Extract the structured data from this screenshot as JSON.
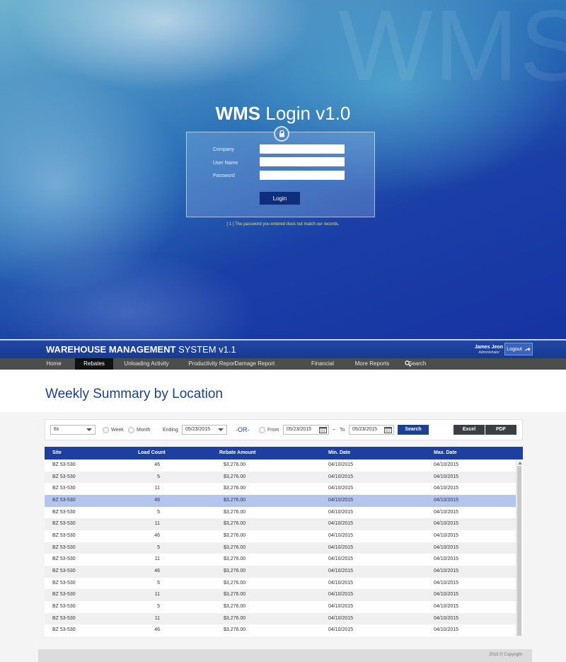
{
  "login": {
    "watermark": "WMS",
    "title_bold": "WMS",
    "title_light": "Login v1.0",
    "fields": [
      {
        "label": "Company",
        "value": ""
      },
      {
        "label": "User Name",
        "value": ""
      },
      {
        "label": "Password",
        "value": ""
      }
    ],
    "login_label": "Login",
    "error_message": "[ 1 ] The password you entered does not match our records."
  },
  "header": {
    "title_bold": "WAREHOUSE MANAGEMENT",
    "title_light": "SYSTEM v1.1",
    "user_name": "James Jeon",
    "user_role": "Administrator",
    "logout_label": "Logout"
  },
  "nav": {
    "items": [
      "Home",
      "Rebates",
      "Unloading Activity",
      "Productivity Report",
      "Damage Report",
      "Financial",
      "More Reports",
      "Search"
    ],
    "active": "Rebates"
  },
  "page": {
    "title": "Weekly Summary by Location"
  },
  "filters": {
    "location_select": "8x",
    "week_label": "Week",
    "month_label": "Month",
    "ending_label": "Ending",
    "ending_date": "05/23/2015",
    "or_label": "-OR-",
    "from_label": "From",
    "from_date": "05/23/2015",
    "tilde": "~",
    "to_label": "To",
    "to_date": "05/23/2015",
    "search_label": "Search",
    "excel_label": "Excel",
    "pdf_label": "PDF"
  },
  "table": {
    "columns": [
      "Site",
      "Load Count",
      "Rebate Amount",
      "Min. Date",
      "Max. Date"
    ],
    "rows": [
      [
        "BZ 53-530",
        "46",
        "$3,276.00",
        "04/10/2015",
        "04/10/2015"
      ],
      [
        "BZ 53-530",
        "5",
        "$3,276.00",
        "04/10/2015",
        "04/10/2015"
      ],
      [
        "BZ 53-530",
        "11",
        "$3,276.00",
        "04/10/2015",
        "04/10/2015"
      ],
      [
        "BZ 53-530",
        "46",
        "$3,276.00",
        "04/10/2015",
        "04/10/2015"
      ],
      [
        "BZ 53-530",
        "5",
        "$3,276.00",
        "04/10/2015",
        "04/10/2015"
      ],
      [
        "BZ 53-530",
        "11",
        "$3,276.00",
        "04/10/2015",
        "04/10/2015"
      ],
      [
        "BZ 53-530",
        "46",
        "$3,276.00",
        "04/10/2015",
        "04/10/2015"
      ],
      [
        "BZ 53-530",
        "5",
        "$3,276.00",
        "04/10/2015",
        "04/10/2015"
      ],
      [
        "BZ 53-530",
        "11",
        "$3,276.00",
        "04/10/2015",
        "04/10/2015"
      ],
      [
        "BZ 53-530",
        "46",
        "$3,276.00",
        "04/10/2015",
        "04/10/2015"
      ],
      [
        "BZ 53-530",
        "5",
        "$3,276.00",
        "04/10/2015",
        "04/10/2015"
      ],
      [
        "BZ 53-530",
        "11",
        "$3,276.00",
        "04/10/2015",
        "04/10/2015"
      ],
      [
        "BZ 53-530",
        "5",
        "$3,276.00",
        "04/10/2015",
        "04/10/2015"
      ],
      [
        "BZ 53-530",
        "11",
        "$3,276.00",
        "04/10/2015",
        "04/10/2015"
      ],
      [
        "BZ 53-530",
        "46",
        "$3,276.00",
        "04/10/2015",
        "04/10/2015"
      ]
    ],
    "selected_row": 3
  },
  "footer": {
    "copyright": "2015 © Copyright"
  },
  "colors": {
    "brand_blue": "#1d3f96",
    "nav_dark": "#4d4d4d",
    "selected_row": "#b4c6ef",
    "error_yellow": "#e7e63b"
  },
  "icons": {
    "lock": "lock-icon",
    "logout": "logout-arrow-icon",
    "search": "search-icon",
    "calendar": "calendar-icon"
  }
}
